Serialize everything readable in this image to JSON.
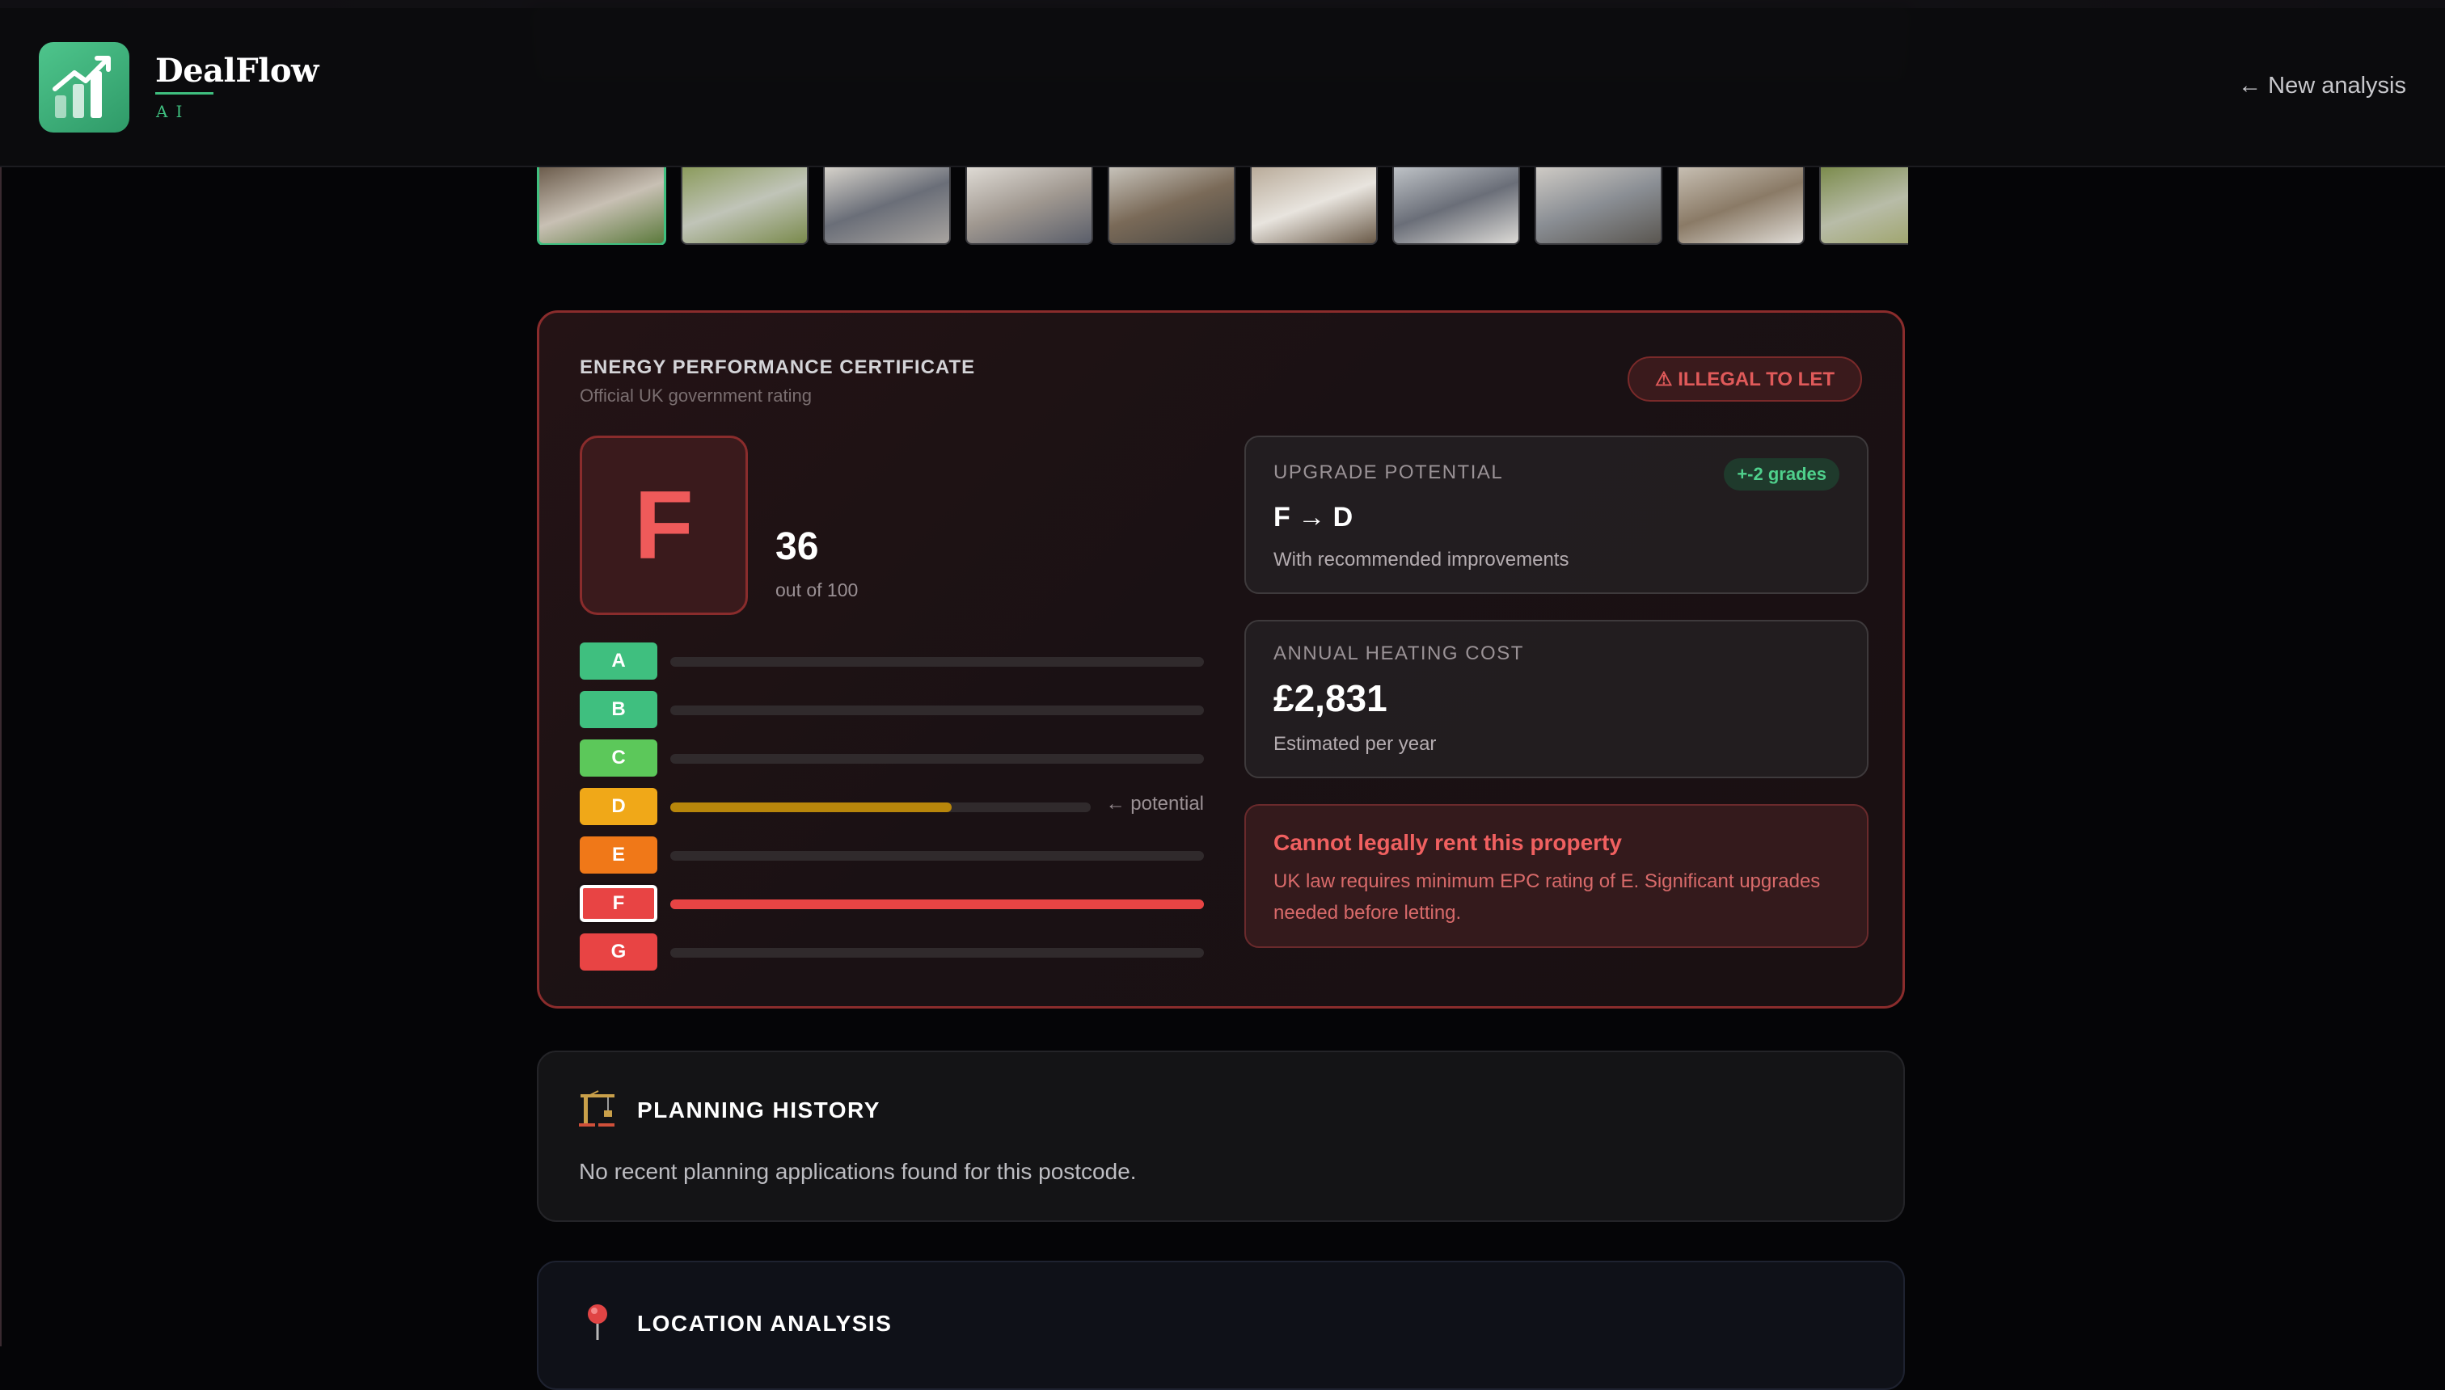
{
  "header": {
    "brand": "DealFlow",
    "brand_sub": "AI",
    "new_analysis": "← New analysis"
  },
  "gallery": {
    "thumbnails": [
      {
        "name": "lodge-exterior",
        "active": true,
        "colors": [
          "#6a5a4a",
          "#c8c0b4",
          "#5c7a3c"
        ]
      },
      {
        "name": "park-aerial",
        "active": false,
        "colors": [
          "#8a9a5a",
          "#c0c4b8",
          "#7a8a4c"
        ]
      },
      {
        "name": "dining-area",
        "active": false,
        "colors": [
          "#d8d4cc",
          "#6a6e78",
          "#a8a4a0"
        ]
      },
      {
        "name": "hallway",
        "active": false,
        "colors": [
          "#e0dcd6",
          "#a09890",
          "#5a5e6a"
        ]
      },
      {
        "name": "kitchen",
        "active": false,
        "colors": [
          "#c8c4bc",
          "#7a6a58",
          "#4a4844"
        ]
      },
      {
        "name": "bedroom",
        "active": false,
        "colors": [
          "#b8aa98",
          "#e8e4de",
          "#6a5a48"
        ]
      },
      {
        "name": "twin-bedroom",
        "active": false,
        "colors": [
          "#c0c4c8",
          "#6a6e78",
          "#dcdad6"
        ]
      },
      {
        "name": "living-kitchen",
        "active": false,
        "colors": [
          "#d0ccc6",
          "#8a8e94",
          "#5a5650"
        ]
      },
      {
        "name": "bathroom",
        "active": false,
        "colors": [
          "#c8c0b4",
          "#8a7a66",
          "#e0dcd6"
        ]
      },
      {
        "name": "site-aerial",
        "active": false,
        "colors": [
          "#7a8a4a",
          "#b8bca8",
          "#9aa060"
        ]
      }
    ]
  },
  "epc": {
    "title": "ENERGY PERFORMANCE CERTIFICATE",
    "subtitle": "Official UK government rating",
    "badge": "⚠ ILLEGAL TO LET",
    "grade": "F",
    "score": "36",
    "score_sub": "out of 100",
    "potential_note": "← potential",
    "bands": [
      {
        "letter": "A",
        "color": "#3fbf7f",
        "fill": 0,
        "current": false,
        "potential": false
      },
      {
        "letter": "B",
        "color": "#3fbf7f",
        "fill": 0,
        "current": false,
        "potential": false
      },
      {
        "letter": "C",
        "color": "#5cc85a",
        "fill": 0,
        "current": false,
        "potential": false
      },
      {
        "letter": "D",
        "color": "#f0a818",
        "fill": 0.67,
        "current": false,
        "potential": true
      },
      {
        "letter": "E",
        "color": "#f07818",
        "fill": 0,
        "current": false,
        "potential": false
      },
      {
        "letter": "F",
        "color": "#e84444",
        "fill": 1,
        "current": true,
        "potential": false
      },
      {
        "letter": "G",
        "color": "#e84444",
        "fill": 0,
        "current": false,
        "potential": false
      }
    ],
    "upgrade": {
      "label": "UPGRADE POTENTIAL",
      "pill": "+-2 grades",
      "value": "F → D",
      "sub": "With recommended improvements"
    },
    "heating": {
      "label": "ANNUAL HEATING COST",
      "value": "£2,831",
      "sub": "Estimated per year"
    },
    "warning": {
      "title": "Cannot legally rent this property",
      "text": "UK law requires minimum EPC rating of E. Significant upgrades needed before letting."
    }
  },
  "planning": {
    "title": "PLANNING HISTORY",
    "text": "No recent planning applications found for this postcode."
  },
  "location": {
    "title": "LOCATION ANALYSIS"
  },
  "colors": {
    "accent": "#3fbf7f",
    "danger": "#e84444"
  }
}
